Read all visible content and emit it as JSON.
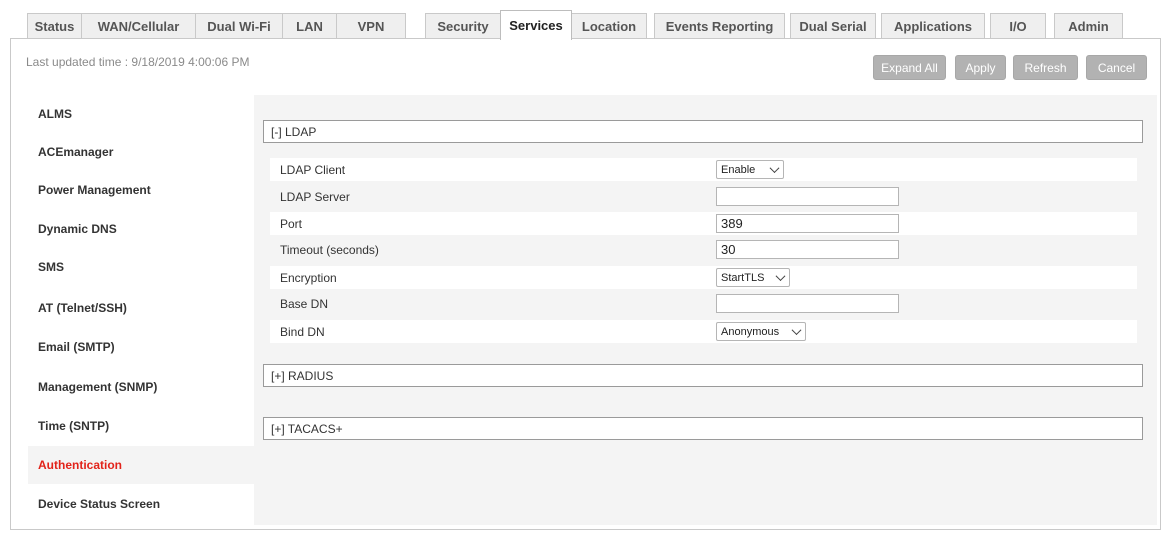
{
  "tabs": [
    {
      "label": "Status",
      "active": false
    },
    {
      "label": "WAN/Cellular",
      "active": false
    },
    {
      "label": "Dual Wi-Fi",
      "active": false
    },
    {
      "label": "LAN",
      "active": false
    },
    {
      "label": "VPN",
      "active": false
    },
    {
      "label": "Security",
      "active": false
    },
    {
      "label": "Services",
      "active": true
    },
    {
      "label": "Location",
      "active": false
    },
    {
      "label": "Events Reporting",
      "active": false
    },
    {
      "label": "Dual Serial",
      "active": false
    },
    {
      "label": "Applications",
      "active": false
    },
    {
      "label": "I/O",
      "active": false
    },
    {
      "label": "Admin",
      "active": false
    }
  ],
  "last_updated": "Last updated time : 9/18/2019 4:00:06 PM",
  "toolbar": {
    "expand_all": "Expand All",
    "apply": "Apply",
    "refresh": "Refresh",
    "cancel": "Cancel"
  },
  "sidebar": {
    "items": [
      {
        "label": "ALMS"
      },
      {
        "label": "ACEmanager"
      },
      {
        "label": "Power Management"
      },
      {
        "label": "Dynamic DNS"
      },
      {
        "label": "SMS"
      },
      {
        "label": "AT (Telnet/SSH)"
      },
      {
        "label": "Email (SMTP)"
      },
      {
        "label": "Management (SNMP)"
      },
      {
        "label": "Time (SNTP)"
      },
      {
        "label": "Authentication",
        "active": true
      },
      {
        "label": "Device Status Screen"
      }
    ]
  },
  "sections": {
    "ldap": {
      "header": "[-] LDAP",
      "fields": {
        "client": {
          "label": "LDAP Client",
          "value": "Enable"
        },
        "server": {
          "label": "LDAP Server",
          "value": ""
        },
        "port": {
          "label": "Port",
          "value": "389"
        },
        "timeout": {
          "label": "Timeout (seconds)",
          "value": "30"
        },
        "encryption": {
          "label": "Encryption",
          "value": "StartTLS"
        },
        "base_dn": {
          "label": "Base DN",
          "value": ""
        },
        "bind_dn": {
          "label": "Bind DN",
          "value": "Anonymous"
        }
      }
    },
    "radius": {
      "header": "[+] RADIUS"
    },
    "tacacs": {
      "header": "[+] TACACS+"
    }
  },
  "colors": {
    "active_sidebar": "#e2231a",
    "button_bg": "#b2b2b2",
    "panel_bg": "#f4f4f4"
  },
  "icons": {
    "dropdown": "chevron-down-icon"
  }
}
